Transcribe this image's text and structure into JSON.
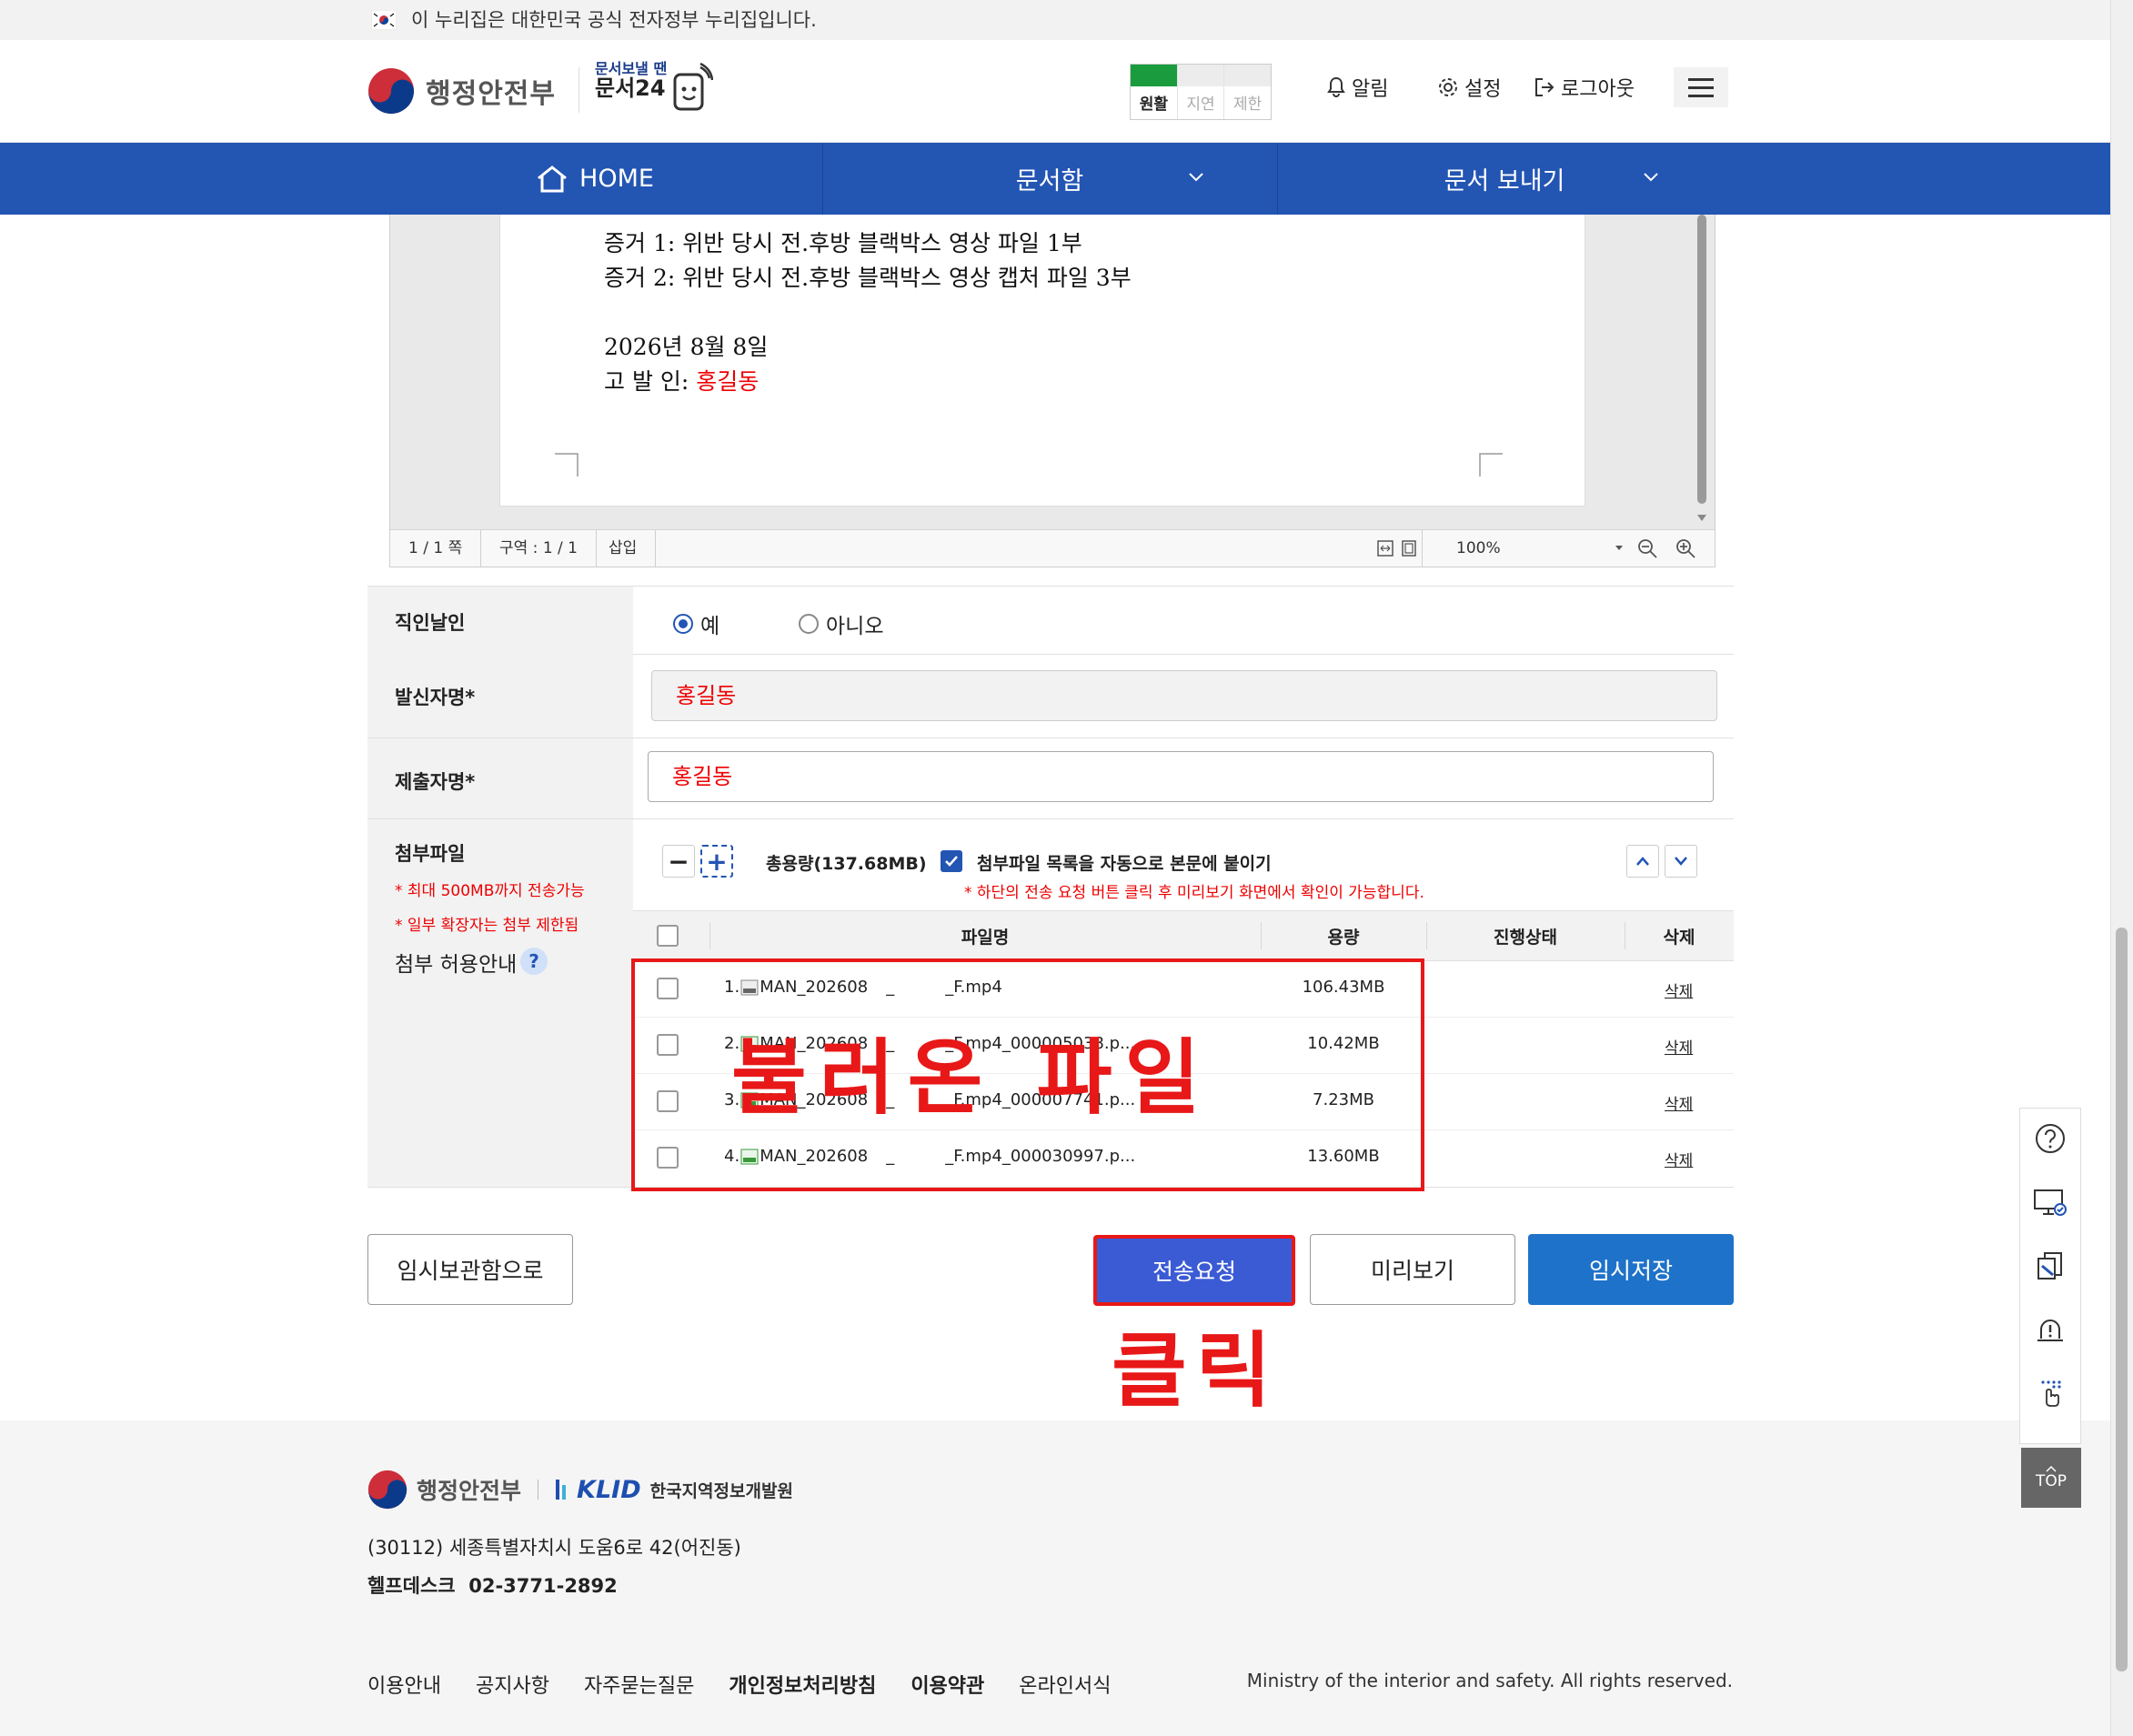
{
  "gov_banner": {
    "text": "이 누리집은 대한민국 공식 전자정부 누리집입니다."
  },
  "header": {
    "ministry_logo": "행정안전부",
    "service_logo_small": "문서보낼 땐",
    "service_logo_big": "문서24",
    "status": [
      {
        "label": "원활",
        "active": true
      },
      {
        "label": "지연",
        "active": false
      },
      {
        "label": "제한",
        "active": false
      }
    ],
    "links": {
      "alert": "알림",
      "settings": "설정",
      "logout": "로그아웃"
    }
  },
  "nav": {
    "home": "HOME",
    "inbox": "문서함",
    "send": "문서 보내기"
  },
  "document": {
    "lines": [
      "증거 1: 위반 당시 전.후방 블랙박스 영상 파일 1부",
      "증거 2: 위반 당시 전.후방 블랙박스 영상 캡처 파일 3부",
      "2026년 8월 8일"
    ],
    "signer_label": "고 발 인: ",
    "signer_name": "홍길동"
  },
  "viewer_status": {
    "page": "1 / 1 쪽",
    "section": "구역 : 1 / 1",
    "mode": "삽입",
    "zoom": "100%"
  },
  "form": {
    "seal": {
      "label": "직인날인",
      "yes": "예",
      "no": "아니오",
      "selected": "yes"
    },
    "sender": {
      "label": "발신자명*",
      "value": "홍길동"
    },
    "submitter": {
      "label": "제출자명*",
      "value": "홍길동"
    },
    "attach": {
      "label": "첨부파일",
      "note1": "* 최대 500MB까지 전송가능",
      "note2": "* 일부 확장자는 첨부 제한됨",
      "guide": "첨부 허용안내",
      "total": "총용량(137.68MB)",
      "auto_label": "첨부파일 목록을 자동으로 본문에 붙이기",
      "auto_note": "* 하단의 전송 요청 버튼 클릭 후 미리보기 화면에서 확인이 가능합니다.",
      "columns": {
        "name": "파일명",
        "size": "용량",
        "status": "진행상태",
        "delete": "삭제"
      },
      "files": [
        {
          "num": "1.",
          "name_a": "MAN_202608",
          "name_b": "_",
          "name_c": "_F.mp4",
          "size": "106.43MB",
          "delete": "삭제"
        },
        {
          "num": "2.",
          "name_a": "MAN_202608",
          "name_b": "_",
          "name_c": "_F.mp4_000005038.p...",
          "size": "10.42MB",
          "delete": "삭제"
        },
        {
          "num": "3.",
          "name_a": "MAN_202608",
          "name_b": "_",
          "name_c": "_F.mp4_000007741.p...",
          "size": "7.23MB",
          "delete": "삭제"
        },
        {
          "num": "4.",
          "name_a": "MAN_202608",
          "name_b": "_",
          "name_c": "_F.mp4_000030997.p...",
          "size": "13.60MB",
          "delete": "삭제"
        }
      ]
    }
  },
  "buttons": {
    "temp_box": "임시보관함으로",
    "send": "전송요청",
    "preview": "미리보기",
    "save": "임시저장"
  },
  "annotations": {
    "files": "불러온 파일",
    "click": "클릭"
  },
  "top_button": "TOP",
  "footer": {
    "ministry": "행정안전부",
    "klid": "KLID",
    "klid_name": "한국지역정보개발원",
    "address": "(30112) 세종특별자치시 도움6로 42(어진동)",
    "helpdesk": "헬프데스크  02-3771-2892",
    "links": [
      "이용안내",
      "공지사항",
      "자주묻는질문",
      "개인정보처리방침",
      "이용약관",
      "온라인서식"
    ],
    "copyright": "Ministry of the interior and safety. All rights reserved."
  },
  "colors": {
    "nav_blue": "#2355b3",
    "save_blue": "#1e72c9",
    "send_blue": "#3b5bd5",
    "annotation_red": "#e81818",
    "status_green": "#1a9c3e"
  }
}
